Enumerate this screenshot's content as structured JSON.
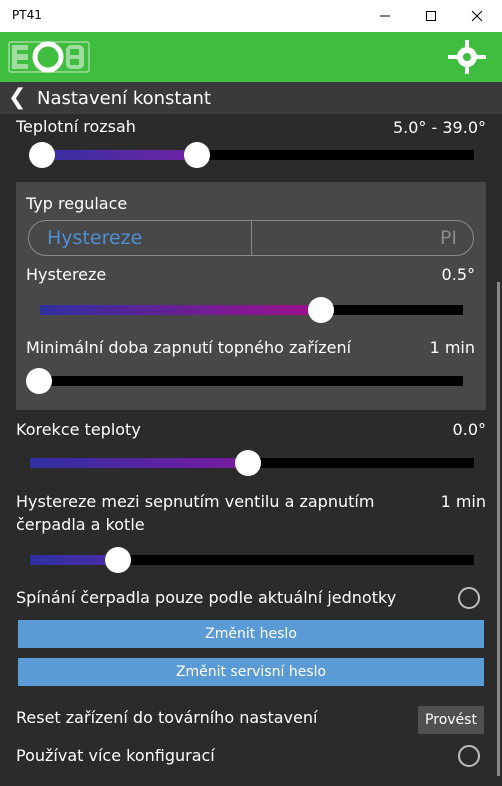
{
  "window": {
    "title": "PT41"
  },
  "controls": {
    "minimize": "—",
    "maximize": "☐",
    "close": "✕"
  },
  "header": {
    "logo_text": "EOB",
    "right_icon": "crosshair-icon"
  },
  "page": {
    "title": "Nastavení konstant",
    "back_icon": "chevron-left-icon"
  },
  "temperature_range": {
    "label": "Teplotní rozsah",
    "value": "5.0° - 39.0°",
    "low_fraction": 0.0,
    "high_fraction": 0.36
  },
  "regulation": {
    "label": "Typ regulace",
    "options": [
      "Hystereze",
      "PI"
    ],
    "selected": "Hystereze",
    "hysteresis": {
      "label": "Hystereze",
      "value": "0.5°",
      "fraction": 0.67
    },
    "min_on_time": {
      "label": "Minimální doba zapnutí topného zařízení",
      "value": "1 min",
      "fraction": 0.0
    }
  },
  "temp_correction": {
    "label": "Korekce teploty",
    "value": "0.0°",
    "fraction": 0.5
  },
  "valve_hysteresis": {
    "label_line1": "Hystereze mezi sepnutím ventilu a zapnutím",
    "label_line2": "čerpadla a kotle",
    "value": "1 min",
    "fraction": 0.2
  },
  "pump_switching": {
    "label": "Spínání čerpadla pouze podle aktuální jednotky",
    "checked": false
  },
  "buttons": {
    "change_password": "Změnit heslo",
    "change_service_password": "Změnit servisní heslo"
  },
  "reset": {
    "label": "Reset zařízení do továrního nastavení",
    "button": "Provést"
  },
  "multi_config": {
    "label": "Používat více konfigurací",
    "checked": false
  },
  "colors": {
    "header_green": "#3ebd3e",
    "accent_blue": "#5b9bd5",
    "slider_gradient_start": "#3030a0",
    "slider_gradient_end": "#a0108a"
  }
}
